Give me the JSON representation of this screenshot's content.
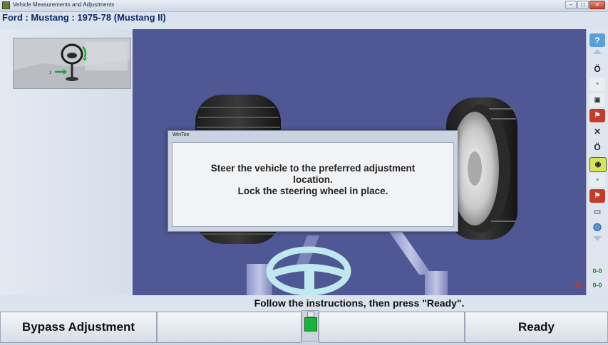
{
  "window": {
    "title": "Vehicle Measurements and Adjustments",
    "buttons": [
      "minimize",
      "maximize",
      "close"
    ]
  },
  "vehicle": {
    "name": "Ford : Mustang : 1975-78 (Mustang II)"
  },
  "dialog": {
    "title": "WinToe",
    "lines": [
      "Steer the vehicle to the preferred adjustment",
      "location.",
      "Lock the steering wheel in place."
    ]
  },
  "instructions": "Follow the instructions, then press \"Ready\".",
  "bottom": {
    "bypass_label": "Bypass Adjustment",
    "ready_label": "Ready",
    "indicator_color": "#19b43a"
  },
  "toolbar": {
    "icons": [
      "help-icon",
      "gauge-icon",
      "camber-readout-icon",
      "toe-readout-icon",
      "checkered-flag-icon",
      "vehicle-icon",
      "gauge-icon",
      "dial-icon",
      "camber-readout-icon",
      "checkered-flag-icon",
      "print-icon",
      "globe-icon",
      "axle-icon"
    ]
  },
  "colors": {
    "viewport_bg": "#4f5894",
    "header_text": "#0e2a6a"
  }
}
